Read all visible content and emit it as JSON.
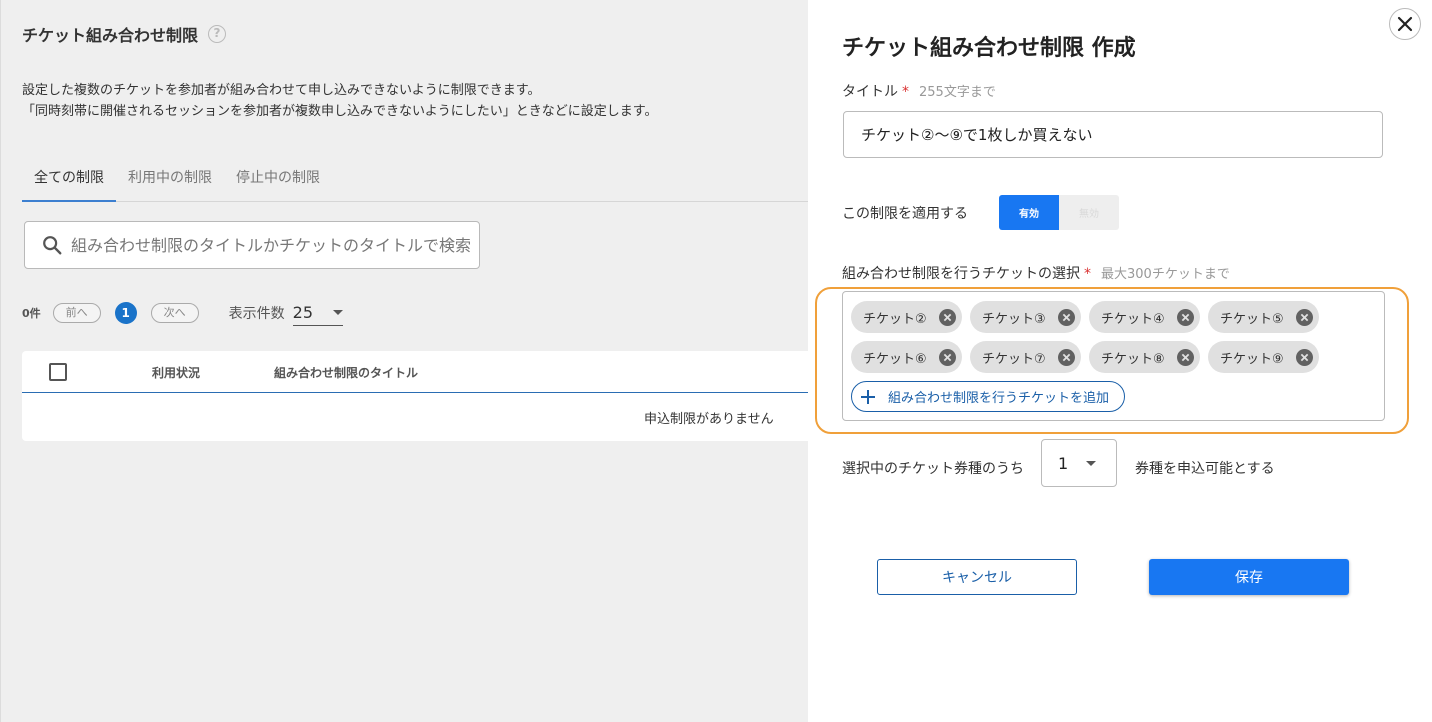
{
  "page": {
    "title": "チケット組み合わせ制限",
    "help_icon": "?",
    "description_line1": "設定した複数のチケットを参加者が組み合わせて申し込みできないように制限できます。",
    "description_line2": "「同時刻帯に開催されるセッションを参加者が複数申し込みできないようにしたい」ときなどに設定します。",
    "tabs": [
      {
        "label": "全ての制限",
        "active": true
      },
      {
        "label": "利用中の制限",
        "active": false
      },
      {
        "label": "停止中の制限",
        "active": false
      }
    ],
    "search": {
      "placeholder": "組み合わせ制限のタイトルかチケットのタイトルで検索",
      "icon": "search-icon"
    },
    "pager": {
      "count": "0件",
      "prev": "前へ",
      "current": "1",
      "next": "次へ",
      "per_page_label": "表示件数",
      "per_page_value": "25"
    },
    "table": {
      "columns": [
        "利用状況",
        "組み合わせ制限のタイトル"
      ],
      "empty_message": "申込制限がありません"
    }
  },
  "drawer": {
    "title": "チケット組み合わせ制限 作成",
    "title_field": {
      "label": "タイトル",
      "required_mark": "*",
      "hint": "255文字まで",
      "value": "チケット②〜⑨で1枚しか買えない"
    },
    "apply": {
      "label": "この制限を適用する",
      "on_label": "有効",
      "off_label": "無効",
      "value": "有効"
    },
    "tickets": {
      "label": "組み合わせ制限を行うチケットの選択",
      "required_mark": "*",
      "hint": "最大300チケットまで",
      "items": [
        "チケット②",
        "チケット③",
        "チケット④",
        "チケット⑤",
        "チケット⑥",
        "チケット⑦",
        "チケット⑧",
        "チケット⑨"
      ],
      "add_label": "組み合わせ制限を行うチケットを追加"
    },
    "limit": {
      "prefix": "選択中のチケット券種のうち",
      "value": "1",
      "suffix": "券種を申込可能とする"
    },
    "cancel_label": "キャンセル",
    "save_label": "保存"
  },
  "colors": {
    "accent": "#1877f2",
    "highlight": "#f0a03a",
    "link": "#1a5fa8"
  }
}
